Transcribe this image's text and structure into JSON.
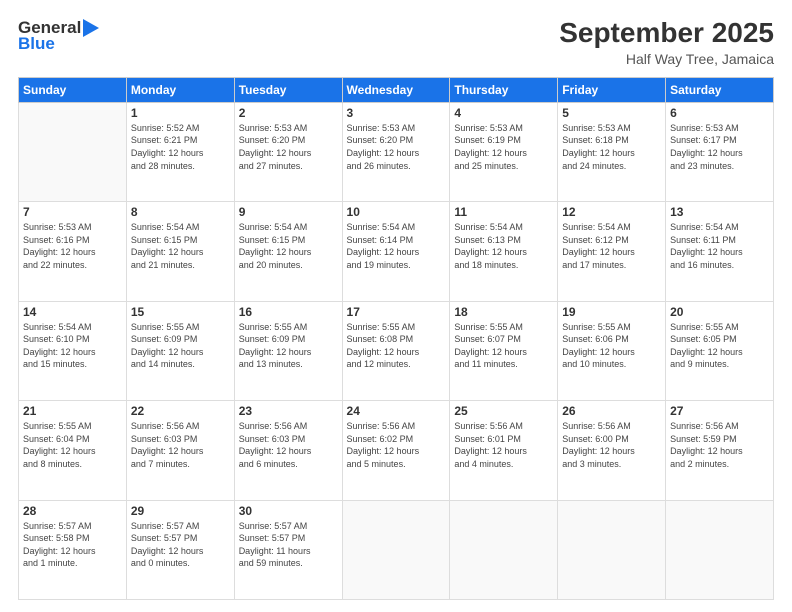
{
  "header": {
    "logo_general": "General",
    "logo_blue": "Blue",
    "month_title": "September 2025",
    "subtitle": "Half Way Tree, Jamaica"
  },
  "weekdays": [
    "Sunday",
    "Monday",
    "Tuesday",
    "Wednesday",
    "Thursday",
    "Friday",
    "Saturday"
  ],
  "weeks": [
    [
      {
        "day": "",
        "info": ""
      },
      {
        "day": "1",
        "info": "Sunrise: 5:52 AM\nSunset: 6:21 PM\nDaylight: 12 hours\nand 28 minutes."
      },
      {
        "day": "2",
        "info": "Sunrise: 5:53 AM\nSunset: 6:20 PM\nDaylight: 12 hours\nand 27 minutes."
      },
      {
        "day": "3",
        "info": "Sunrise: 5:53 AM\nSunset: 6:20 PM\nDaylight: 12 hours\nand 26 minutes."
      },
      {
        "day": "4",
        "info": "Sunrise: 5:53 AM\nSunset: 6:19 PM\nDaylight: 12 hours\nand 25 minutes."
      },
      {
        "day": "5",
        "info": "Sunrise: 5:53 AM\nSunset: 6:18 PM\nDaylight: 12 hours\nand 24 minutes."
      },
      {
        "day": "6",
        "info": "Sunrise: 5:53 AM\nSunset: 6:17 PM\nDaylight: 12 hours\nand 23 minutes."
      }
    ],
    [
      {
        "day": "7",
        "info": "Sunrise: 5:53 AM\nSunset: 6:16 PM\nDaylight: 12 hours\nand 22 minutes."
      },
      {
        "day": "8",
        "info": "Sunrise: 5:54 AM\nSunset: 6:15 PM\nDaylight: 12 hours\nand 21 minutes."
      },
      {
        "day": "9",
        "info": "Sunrise: 5:54 AM\nSunset: 6:15 PM\nDaylight: 12 hours\nand 20 minutes."
      },
      {
        "day": "10",
        "info": "Sunrise: 5:54 AM\nSunset: 6:14 PM\nDaylight: 12 hours\nand 19 minutes."
      },
      {
        "day": "11",
        "info": "Sunrise: 5:54 AM\nSunset: 6:13 PM\nDaylight: 12 hours\nand 18 minutes."
      },
      {
        "day": "12",
        "info": "Sunrise: 5:54 AM\nSunset: 6:12 PM\nDaylight: 12 hours\nand 17 minutes."
      },
      {
        "day": "13",
        "info": "Sunrise: 5:54 AM\nSunset: 6:11 PM\nDaylight: 12 hours\nand 16 minutes."
      }
    ],
    [
      {
        "day": "14",
        "info": "Sunrise: 5:54 AM\nSunset: 6:10 PM\nDaylight: 12 hours\nand 15 minutes."
      },
      {
        "day": "15",
        "info": "Sunrise: 5:55 AM\nSunset: 6:09 PM\nDaylight: 12 hours\nand 14 minutes."
      },
      {
        "day": "16",
        "info": "Sunrise: 5:55 AM\nSunset: 6:09 PM\nDaylight: 12 hours\nand 13 minutes."
      },
      {
        "day": "17",
        "info": "Sunrise: 5:55 AM\nSunset: 6:08 PM\nDaylight: 12 hours\nand 12 minutes."
      },
      {
        "day": "18",
        "info": "Sunrise: 5:55 AM\nSunset: 6:07 PM\nDaylight: 12 hours\nand 11 minutes."
      },
      {
        "day": "19",
        "info": "Sunrise: 5:55 AM\nSunset: 6:06 PM\nDaylight: 12 hours\nand 10 minutes."
      },
      {
        "day": "20",
        "info": "Sunrise: 5:55 AM\nSunset: 6:05 PM\nDaylight: 12 hours\nand 9 minutes."
      }
    ],
    [
      {
        "day": "21",
        "info": "Sunrise: 5:55 AM\nSunset: 6:04 PM\nDaylight: 12 hours\nand 8 minutes."
      },
      {
        "day": "22",
        "info": "Sunrise: 5:56 AM\nSunset: 6:03 PM\nDaylight: 12 hours\nand 7 minutes."
      },
      {
        "day": "23",
        "info": "Sunrise: 5:56 AM\nSunset: 6:03 PM\nDaylight: 12 hours\nand 6 minutes."
      },
      {
        "day": "24",
        "info": "Sunrise: 5:56 AM\nSunset: 6:02 PM\nDaylight: 12 hours\nand 5 minutes."
      },
      {
        "day": "25",
        "info": "Sunrise: 5:56 AM\nSunset: 6:01 PM\nDaylight: 12 hours\nand 4 minutes."
      },
      {
        "day": "26",
        "info": "Sunrise: 5:56 AM\nSunset: 6:00 PM\nDaylight: 12 hours\nand 3 minutes."
      },
      {
        "day": "27",
        "info": "Sunrise: 5:56 AM\nSunset: 5:59 PM\nDaylight: 12 hours\nand 2 minutes."
      }
    ],
    [
      {
        "day": "28",
        "info": "Sunrise: 5:57 AM\nSunset: 5:58 PM\nDaylight: 12 hours\nand 1 minute."
      },
      {
        "day": "29",
        "info": "Sunrise: 5:57 AM\nSunset: 5:57 PM\nDaylight: 12 hours\nand 0 minutes."
      },
      {
        "day": "30",
        "info": "Sunrise: 5:57 AM\nSunset: 5:57 PM\nDaylight: 11 hours\nand 59 minutes."
      },
      {
        "day": "",
        "info": ""
      },
      {
        "day": "",
        "info": ""
      },
      {
        "day": "",
        "info": ""
      },
      {
        "day": "",
        "info": ""
      }
    ]
  ]
}
